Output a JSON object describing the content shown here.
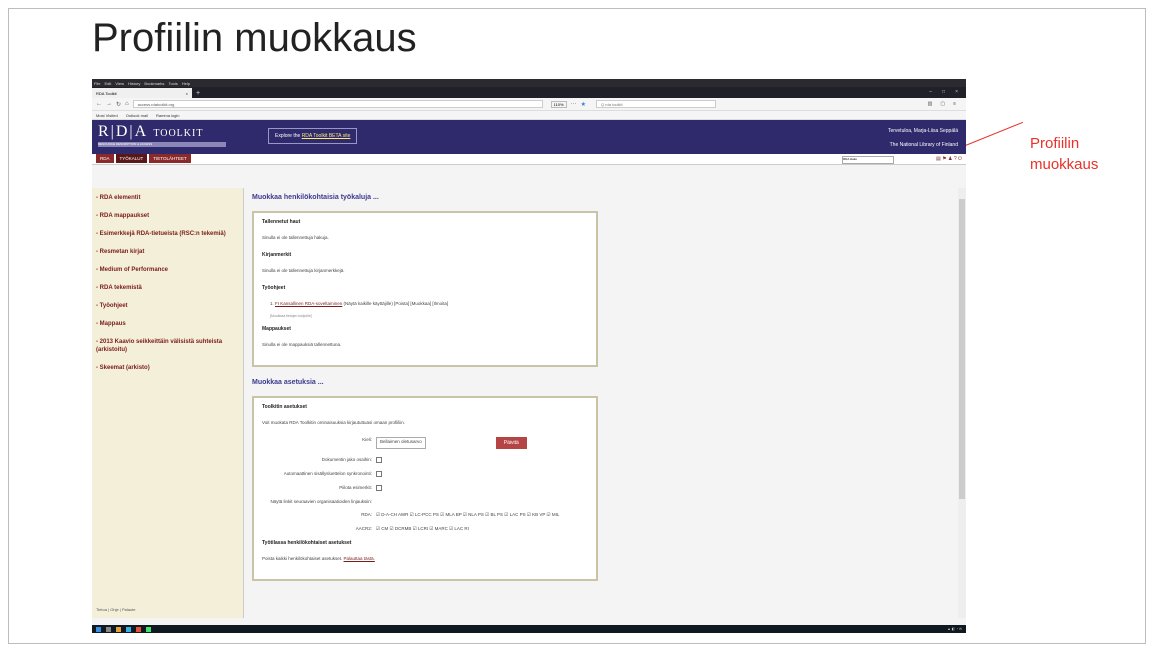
{
  "slide": {
    "title": "Profiilin muokkaus",
    "annotation_line1": "Profiilin",
    "annotation_line2": "muokkaus",
    "accent": "#e8322a"
  },
  "browser": {
    "menu": [
      "File",
      "Edit",
      "View",
      "History",
      "Bookmarks",
      "Tools",
      "Help"
    ],
    "tab_title": "RDA Toolkit",
    "url": "access.rdatoolkit.org",
    "zoom": "110%",
    "search_placeholder": "Q  rda toolkit",
    "bookmarks": [
      "Most Visited",
      "Outlook mail",
      "Ramma login"
    ]
  },
  "header": {
    "logo_text": "R|D|A",
    "logo_small": "TOOLKIT",
    "logo_sub": "RESOURCE DESCRIPTION & ACCESS",
    "explore_prefix": "Explore the ",
    "explore_link": "RDA Toolkit BETA site",
    "user_name": "Tervetuloa, Marja-Liisa Seppälä",
    "org": "The National Library of Finland",
    "bg": "#2e2a6b"
  },
  "tabs": [
    "RDA",
    "TYÖKALUT",
    "TIETOLÄHTEET"
  ],
  "search_box": "RDA Haku",
  "leftnav": {
    "items": [
      "- RDA elementit",
      "- RDA mappaukset",
      "- Esimerkkejä RDA-tietueista (RSC:n tekemiä)",
      "- Resmetan kirjat",
      "- Medium of Performance",
      "- RDA tekemistä",
      "- Työohjeet",
      "- Mappaus",
      "- 2013 Kaavio seikkeittäin välisistä suhteista (arkistoitu)",
      "- Skeemat (arkisto)"
    ],
    "footer": "Tietoa  |  Ohje  |  Palaute"
  },
  "workspace": {
    "title": "Muokkaa henkilökohtaisia työkaluja ...",
    "saved_searches_h": "Tallennetut haut",
    "saved_searches_p": "Sinulla ei ole tallennettuja hakuja.",
    "bookmarks_h": "Kirjanmerkit",
    "bookmarks_p": "Sinulla ei ole tallennettuja kirjanmerkkejä.",
    "workflows_h": "Työohjeet",
    "workflow_item_prefix": "1. ",
    "workflow_item_link": "FI Kansallinen RDA-soveltaminen",
    "workflow_item_rest": " (Näytä kaikille käyttäjille) [Poista] [Muokkaa] [Ilmoita]",
    "workflow_item_sub": "[Muokkaa tietojen lukijoille]",
    "maps_h": "Mappaukset",
    "maps_p": "Sinulla ei ole mappauksiä tallennettuna."
  },
  "settings": {
    "title": "Muokkaa asetuksia ...",
    "toolkit_h": "Toolkitin asetukset",
    "toolkit_p": "Voit muokata RDA Toolkitin ominaisuuksia kirjaututtuasi omaan profiiliin.",
    "lang_label": "Kieli:",
    "lang_value": "Bellaimen oletusarvo",
    "refresh_btn": "Päivitä",
    "doc_label": "Dokumentin jako osaihin:",
    "auto_label": "Automaattinen sisällysluettelon synkronointi:",
    "pics_label": "Piilota esimerkit:",
    "show_label": "Näytä linkit seuraavien organisaatioiden linjauksiin:",
    "rda_label": "RDA:",
    "rda_opts": "☑ D-A-CH AWR  ☑ LC-PCC PS  ☑ MLA BP  ☑ NLA PS  ☑ BL PS  ☑ LAC PS  ☑ KB VP  ☑ MIL",
    "aacr_label": "AACR2:",
    "aacr_opts": "☑ CM  ☑ DCRMB  ☑ LCRI  ☑ MARC  ☑ LAC RI",
    "personal_h": "Työtilassa henkilökohtaiset asetukset",
    "personal_p_prefix": "Poista kaikki henkilökohtaiset asetukset. ",
    "personal_p_link": "Palauttaa tästä."
  }
}
